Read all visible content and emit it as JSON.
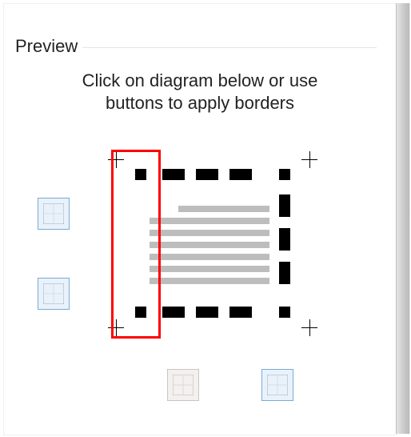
{
  "section_title": "Preview",
  "instructions_line1": "Click on diagram below or use",
  "instructions_line2": "buttons to apply borders",
  "buttons": {
    "top_border": "top-border-toggle",
    "bottom_border": "bottom-border-toggle",
    "left_border": "left-border-toggle",
    "right_border": "right-border-toggle"
  },
  "highlight": {
    "target": "left-border-region"
  },
  "preview_page": {
    "borders": {
      "top": "dashed",
      "right": "dashed",
      "bottom": "dashed",
      "left": "none"
    },
    "paragraph_lines": 7
  }
}
